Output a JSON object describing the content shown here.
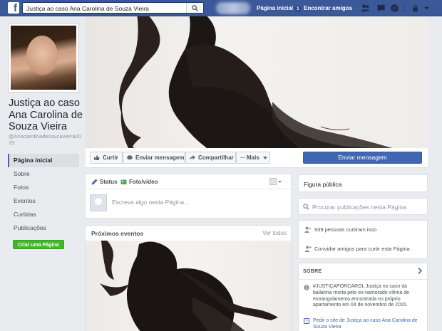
{
  "topbar": {
    "search_value": "Justiça ao caso Ana Carolina de Souza Vieira",
    "nav_home": "Página inicial",
    "nav_home_badge": "1",
    "nav_find_friends": "Encontrar amigos"
  },
  "page": {
    "name": "Justiça ao caso Ana Carolina de Souza Vieira",
    "handle": "@Anacarolinadesouzavieira2015"
  },
  "left_nav": {
    "items": [
      {
        "label": "Página inicial"
      },
      {
        "label": "Sobre"
      },
      {
        "label": "Fotos"
      },
      {
        "label": "Eventos"
      },
      {
        "label": "Curtidas"
      },
      {
        "label": "Publicações"
      }
    ],
    "create_page": "Criar uma Página"
  },
  "actions": {
    "like": "Curtir",
    "send_message": "Enviar mensagem",
    "share": "Compartilhar",
    "more": "Mais",
    "primary_send_message": "Enviar mensagem"
  },
  "composer": {
    "tab_status": "Status",
    "tab_photo": "Foto/vídeo",
    "placeholder": "Escreva algo nesta Página..."
  },
  "events": {
    "title": "Próximos eventos",
    "see_all": "Ver todos"
  },
  "right": {
    "category": "Figura pública",
    "search_placeholder": "Procurar publicações nesta Página",
    "likes": "939 pessoas curtiram isso",
    "invite": "Convidar amigos para curtir esta Página",
    "about_title": "SOBRE",
    "about_text": "#JUSTIÇAPORCAROL Justiça no caso da bailarina morta pelo ex-namorado vítima de estrangulamento,encontrada no próprio apartamento em 04 de novembro de 2015.",
    "about_link": "Pedir o site de Justiça ao caso Ana Carolina de Souza Vieira"
  },
  "colors": {
    "brand": "#3b5998",
    "button_blue": "#4267b2",
    "create_green": "#42b72a",
    "background": "#e9ebee"
  }
}
